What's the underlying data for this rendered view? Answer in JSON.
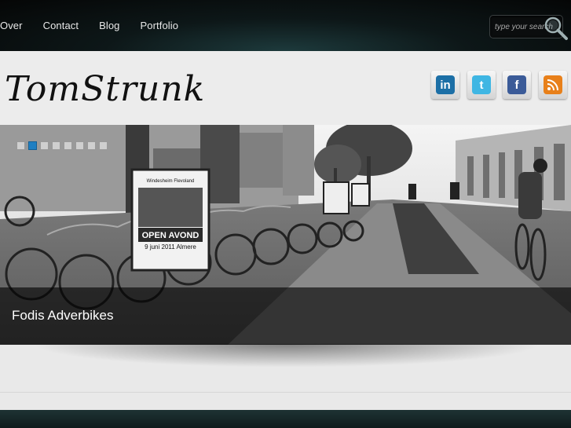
{
  "nav": {
    "items": [
      "Over",
      "Contact",
      "Blog",
      "Portfolio"
    ]
  },
  "search": {
    "placeholder": "type your search"
  },
  "logo": {
    "text": "TomStrunk"
  },
  "social": [
    "linkedin",
    "twitter",
    "facebook",
    "rss"
  ],
  "slider": {
    "dot_count": 8,
    "active_index": 1,
    "caption": "Fodis Adverbikes",
    "poster": {
      "line1": "Windesheim Flevoland",
      "line2": "OPEN AVOND",
      "line3": "9 juni 2011 Almere"
    }
  }
}
